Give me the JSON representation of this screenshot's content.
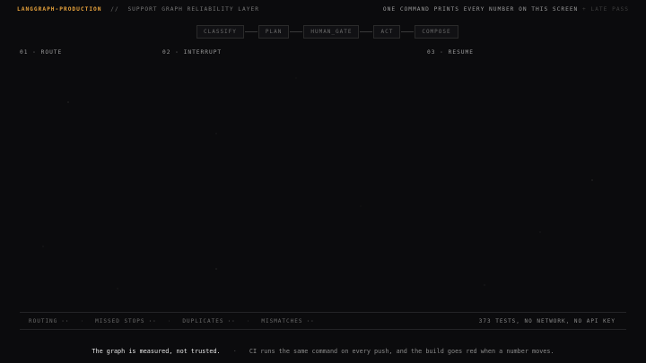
{
  "header": {
    "brand": "LANGGRAPH-PRODUCTION",
    "separator": "//",
    "subtitle": "SUPPORT GRAPH RELIABILITY LAYER",
    "tagline": "ONE COMMAND PRINTS EVERY NUMBER ON THIS SCREEN",
    "tagline_extra": "+ LATE PASS"
  },
  "pipeline": {
    "nodes": [
      "CLASSIFY",
      "PLAN",
      "HUMAN_GATE",
      "ACT",
      "COMPOSE"
    ]
  },
  "sections": [
    {
      "label": "01 · ROUTE"
    },
    {
      "label": "02 · INTERRUPT"
    },
    {
      "label": "03 · RESUME"
    }
  ],
  "metrics": {
    "items": [
      {
        "label": "ROUTING",
        "value": "··"
      },
      {
        "label": "MISSED STOPS",
        "value": "··"
      },
      {
        "label": "DUPLICATES",
        "value": "··"
      },
      {
        "label": "MISMATCHES",
        "value": "··"
      }
    ],
    "summary": "373 TESTS, NO NETWORK, NO API KEY"
  },
  "footer": {
    "strong": "The graph is measured, not trusted.",
    "separator": "·",
    "note": "CI runs the same command on every push, and the build goes red when a number moves."
  },
  "colors": {
    "background": "#0b0b0d",
    "accent": "#e8a33c",
    "text": "#8a8a8a"
  }
}
